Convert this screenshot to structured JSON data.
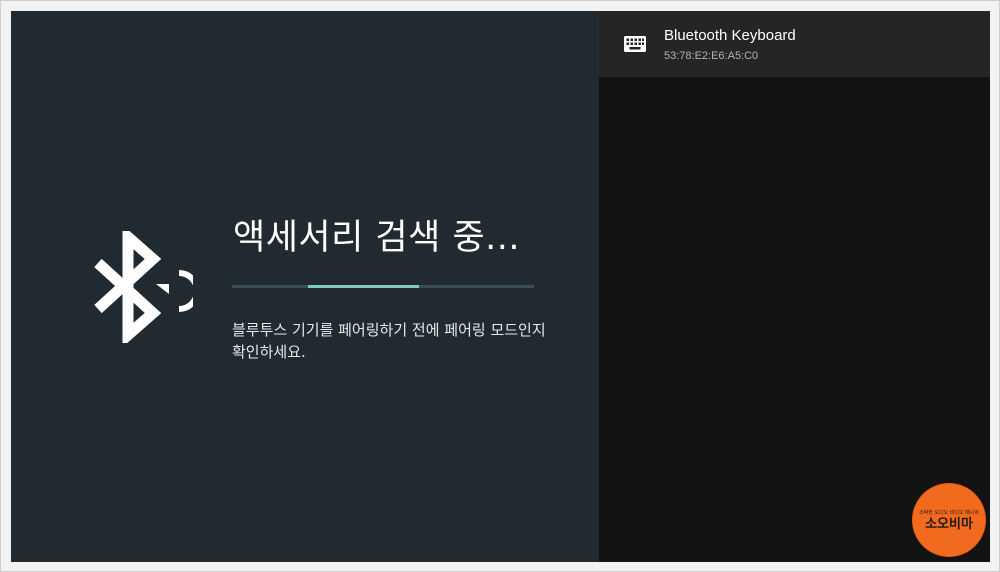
{
  "pairing": {
    "title": "액세서리 검색 중...",
    "progress": 0.37,
    "instructions": "블루투스 기기를 페어링하기 전에 페어링 모드인지 확인하세요.",
    "icon": "bluetooth-searching-icon"
  },
  "devices": [
    {
      "name": "Bluetooth Keyboard",
      "address": "53:78:E2:E6:A5:C0",
      "icon": "keyboard-icon"
    }
  ],
  "watermark": {
    "tagline": "소박한 오디오 비디오 매니아",
    "name": "소오비마"
  },
  "colors": {
    "left_panel_bg": "#212a31",
    "right_panel_bg": "#131313",
    "selected_item_bg": "#252525",
    "progress_track": "#3b4e55",
    "progress_fill": "#80cbc4",
    "watermark_bg": "#f26a1e"
  }
}
